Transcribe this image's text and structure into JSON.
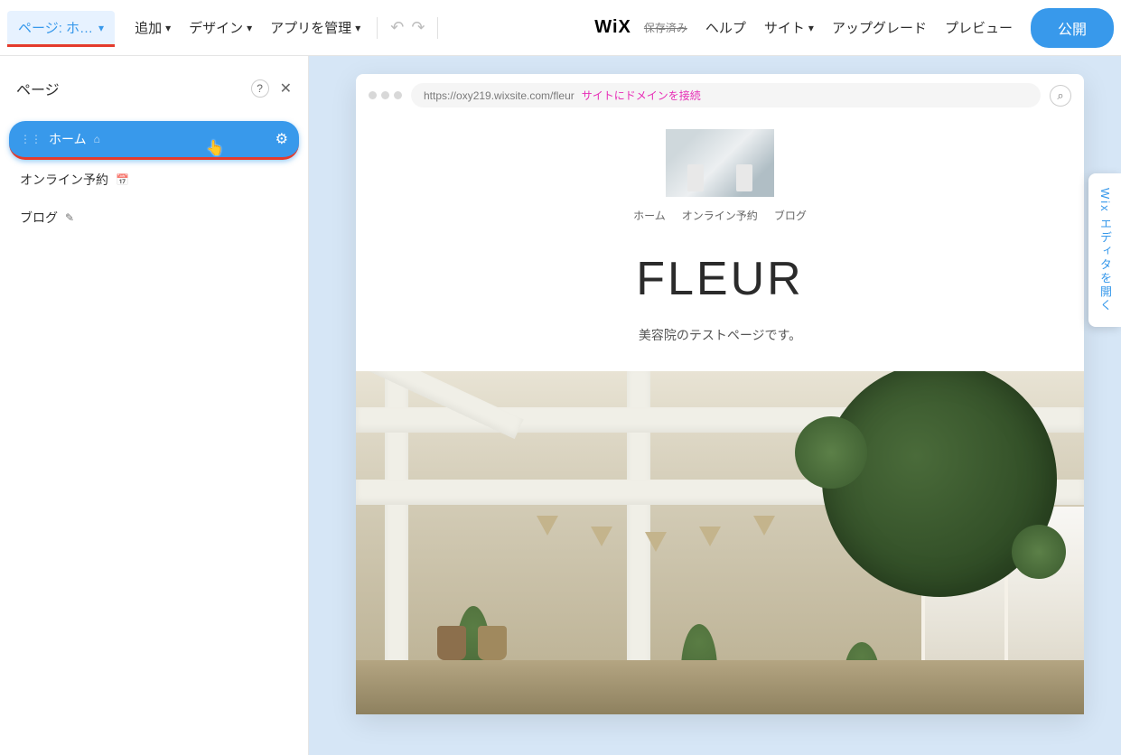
{
  "topbar": {
    "page_selector_label": "ページ: ホ…",
    "menu": {
      "add": "追加",
      "design": "デザイン",
      "manage_apps": "アプリを管理"
    },
    "logo": "WiX",
    "status": "保存済み",
    "help": "ヘルプ",
    "site": "サイト",
    "upgrade": "アップグレード",
    "preview": "プレビュー",
    "publish": "公開"
  },
  "leftpanel": {
    "title": "ページ",
    "help_symbol": "?",
    "close_symbol": "✕",
    "items": [
      {
        "label": "ホーム",
        "icon": "⌂",
        "gear": "⚙",
        "active": true
      },
      {
        "label": "オンライン予約",
        "icon": "📅",
        "active": false
      },
      {
        "label": "ブログ",
        "icon": "✎",
        "active": false
      }
    ]
  },
  "frame": {
    "url": "https://oxy219.wixsite.com/fleur",
    "domain_link": "サイトにドメインを接続"
  },
  "site": {
    "nav": {
      "home": "ホーム",
      "booking": "オンライン予約",
      "blog": "ブログ"
    },
    "title": "FLEUR",
    "subtitle": "美容院のテストページです。"
  },
  "right_tab": "Wix エディタを開く"
}
